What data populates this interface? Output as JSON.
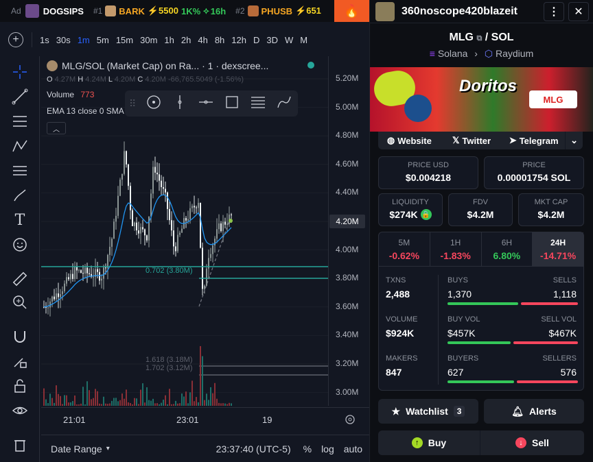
{
  "adbar": {
    "ad_label": "Ad",
    "sponsor": "DOGSIPS",
    "t1_rank": "#1",
    "t1_name": "BARK",
    "t1_boost": "⚡5500",
    "t1_pct": "1K%",
    "t1_time": "16h",
    "t2_rank": "#2",
    "t2_name": "PHUSB",
    "t2_boost": "⚡651"
  },
  "timeframes": [
    "1s",
    "30s",
    "1m",
    "5m",
    "15m",
    "30m",
    "1h",
    "2h",
    "4h",
    "8h",
    "12h",
    "D",
    "3D",
    "W",
    "M"
  ],
  "selected_timeframe": "1m",
  "legend": {
    "title": "MLG/SOL (Market Cap) on Ra... · 1 · dexscree...",
    "o_label": "O",
    "o_val": "4.27M",
    "h_label": "H",
    "h_val": "4.24M",
    "l_label": "L",
    "l_val": "4.20M",
    "c_label": "C",
    "c_val": "4.20M",
    "chg": "-66,765.5049 (-1.56%)",
    "volume_label": "Volume",
    "volume_val": "773",
    "ema": "EMA 13 close 0 SMA"
  },
  "price_axis": [
    "5.20M",
    "5.00M",
    "4.80M",
    "4.60M",
    "4.40M",
    "4.20M",
    "4.00M",
    "3.80M",
    "3.60M",
    "3.40M",
    "3.20M",
    "3.00M"
  ],
  "price_current": "4.20M",
  "fib_labels": {
    "a": "0.702 (3.80M)",
    "b": "1.618 (3.18M)",
    "c": "1.702 (3.12M)"
  },
  "time_axis": [
    "21:01",
    "23:01",
    "19"
  ],
  "bottom": {
    "date_range": "Date Range",
    "time": "23:37:40 (UTC-5)",
    "pct": "%",
    "log": "log",
    "auto": "auto"
  },
  "user": {
    "name": "360noscope420blazeit"
  },
  "pair": {
    "base": "MLG",
    "sep": "/",
    "quote": "SOL",
    "chain": "Solana",
    "dex": "Raydium"
  },
  "banner": {
    "brand": "Doritos",
    "tag": "MLG"
  },
  "links": {
    "website": "Website",
    "twitter": "Twitter",
    "telegram": "Telegram"
  },
  "stats": {
    "price_usd_label": "PRICE USD",
    "price_usd": "$0.004218",
    "price_label": "PRICE",
    "price_sol": "0.00001754 SOL",
    "liq_label": "LIQUIDITY",
    "liq": "$274K",
    "fdv_label": "FDV",
    "fdv": "$4.2M",
    "mcap_label": "MKT CAP",
    "mcap": "$4.2M"
  },
  "periods": [
    {
      "label": "5M",
      "change": "-0.62%"
    },
    {
      "label": "1H",
      "change": "-1.83%"
    },
    {
      "label": "6H",
      "change": "6.80%"
    },
    {
      "label": "24H",
      "change": "-14.71%"
    }
  ],
  "tx": {
    "txns_label": "TXNS",
    "txns": "2,488",
    "buys_label": "BUYS",
    "buys": "1,370",
    "sells_label": "SELLS",
    "sells": "1,118",
    "volume_label": "VOLUME",
    "volume": "$924K",
    "buyvol_label": "BUY VOL",
    "buyvol": "$457K",
    "sellvol_label": "SELL VOL",
    "sellvol": "$467K",
    "makers_label": "MAKERS",
    "makers": "847",
    "buyers_label": "BUYERS",
    "buyers": "627",
    "sellers_label": "SELLERS",
    "sellers": "576"
  },
  "actions": {
    "watchlist": "Watchlist",
    "watch_count": "3",
    "alerts": "Alerts",
    "buy": "Buy",
    "sell": "Sell"
  },
  "colors": {
    "up": "#26a69a",
    "down": "#ef5350",
    "accent": "#2962ff",
    "ema": "#2196f3"
  }
}
